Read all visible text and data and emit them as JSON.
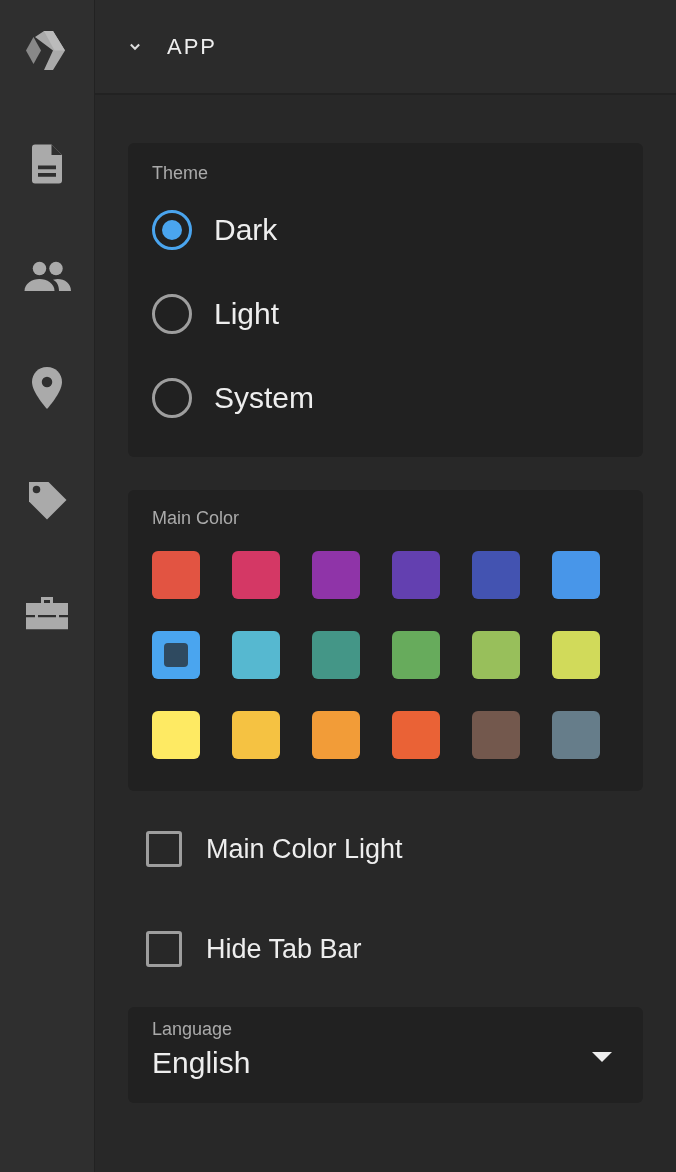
{
  "sidebar": {
    "items": [
      {
        "kind": "logo"
      },
      {
        "kind": "document"
      },
      {
        "kind": "people"
      },
      {
        "kind": "pin"
      },
      {
        "kind": "tag"
      },
      {
        "kind": "toolbox"
      }
    ]
  },
  "header": {
    "title": "APP",
    "expanded": true
  },
  "theme": {
    "label": "Theme",
    "options": [
      {
        "label": "Dark",
        "selected": true
      },
      {
        "label": "Light",
        "selected": false
      },
      {
        "label": "System",
        "selected": false
      }
    ]
  },
  "main_color": {
    "label": "Main Color",
    "swatches": [
      {
        "color": "#e25442",
        "selected": false
      },
      {
        "color": "#d43865",
        "selected": false
      },
      {
        "color": "#8f34a8",
        "selected": false
      },
      {
        "color": "#6340b0",
        "selected": false
      },
      {
        "color": "#4353b1",
        "selected": false
      },
      {
        "color": "#4896e9",
        "selected": false
      },
      {
        "color": "#4aa5ef",
        "selected": true
      },
      {
        "color": "#56b8d0",
        "selected": false
      },
      {
        "color": "#449687",
        "selected": false
      },
      {
        "color": "#67ab5c",
        "selected": false
      },
      {
        "color": "#98bf5b",
        "selected": false
      },
      {
        "color": "#d1da5a",
        "selected": false
      },
      {
        "color": "#feea63",
        "selected": false
      },
      {
        "color": "#f5c242",
        "selected": false
      },
      {
        "color": "#f29c38",
        "selected": false
      },
      {
        "color": "#ea6236",
        "selected": false
      },
      {
        "color": "#73584d",
        "selected": false
      },
      {
        "color": "#667d8a",
        "selected": false
      }
    ]
  },
  "options": [
    {
      "label": "Main Color Light",
      "checked": false
    },
    {
      "label": "Hide Tab Bar",
      "checked": false
    }
  ],
  "language": {
    "label": "Language",
    "value": "English"
  }
}
